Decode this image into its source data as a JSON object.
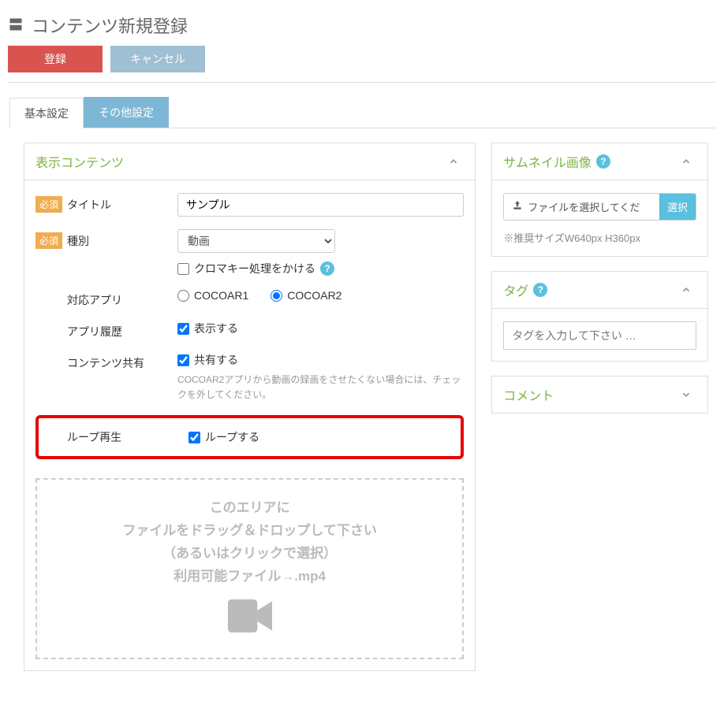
{
  "header": {
    "title": "コンテンツ新規登録",
    "register_btn": "登録",
    "cancel_btn": "キャンセル"
  },
  "tabs": {
    "basic": "基本設定",
    "other": "その他設定"
  },
  "display_panel": {
    "title": "表示コンテンツ",
    "required_badge": "必須",
    "title_label": "タイトル",
    "title_value": "サンプル",
    "type_label": "種別",
    "type_value": "動画",
    "chroma_label": "クロマキー処理をかける",
    "app_label": "対応アプリ",
    "app_option1": "COCOAR1",
    "app_option2": "COCOAR2",
    "history_label": "アプリ履歴",
    "history_check": "表示する",
    "share_label": "コンテンツ共有",
    "share_check": "共有する",
    "share_note": "COCOAR2アプリから動画の録画をさせたくない場合には、チェックを外してください。",
    "loop_label": "ループ再生",
    "loop_check": "ループする",
    "dropzone_line1": "このエリアに",
    "dropzone_line2": "ファイルをドラッグ＆ドロップして下さい",
    "dropzone_line3": "（あるいはクリックで選択）",
    "dropzone_line4": "利用可能ファイル→.mp4"
  },
  "thumbnail_panel": {
    "title": "サムネイル画像",
    "upload_label": "ファイルを選択してくだ",
    "upload_btn": "選択",
    "size_note": "※推奨サイズW640px H360px"
  },
  "tag_panel": {
    "title": "タグ",
    "placeholder": "タグを入力して下さい …"
  },
  "comment_panel": {
    "title": "コメント"
  }
}
